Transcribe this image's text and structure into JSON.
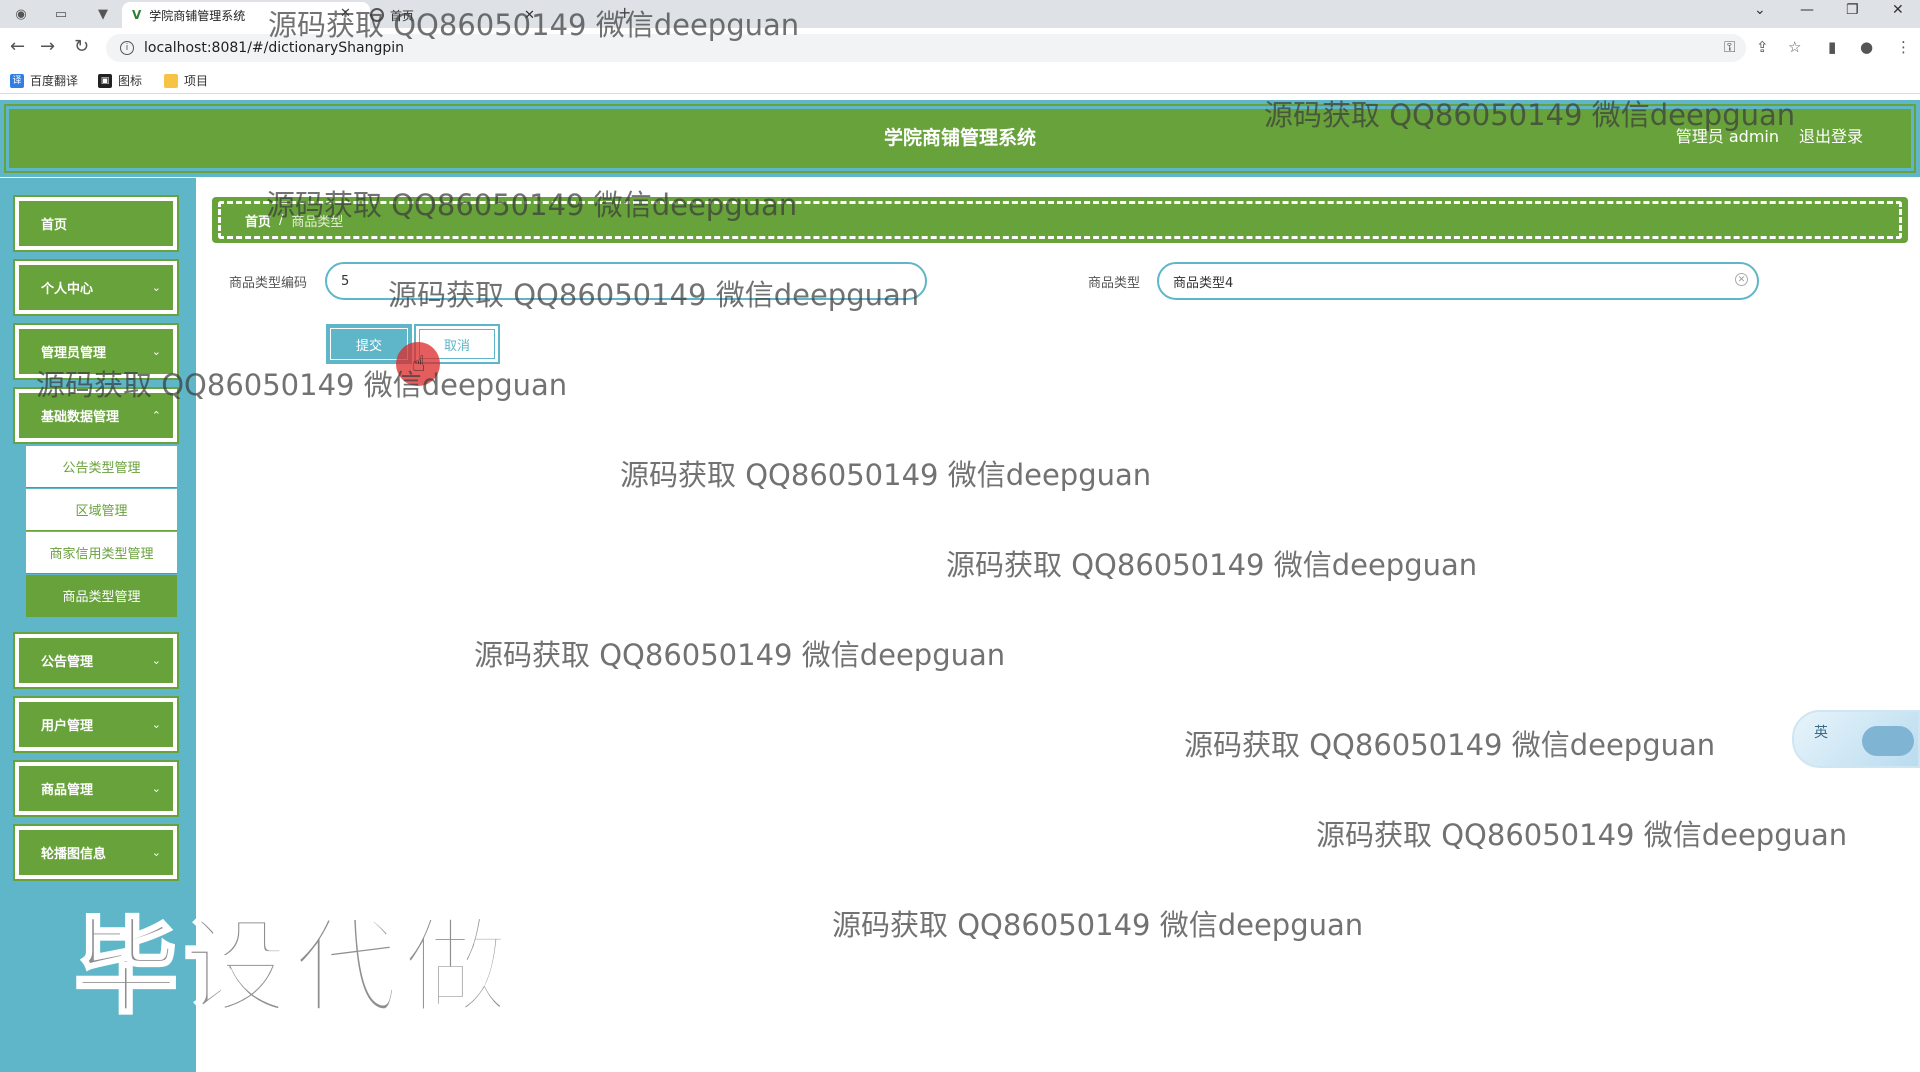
{
  "browser": {
    "tab_title": "学院商铺管理系统",
    "tab2_title": "首页",
    "url": "localhost:8081/#/dictionaryShangpin",
    "bookmarks": [
      "百度翻译",
      "图标",
      "项目"
    ]
  },
  "header": {
    "title": "学院商铺管理系统",
    "user": "管理员 admin",
    "logout": "退出登录"
  },
  "sidebar": {
    "items": [
      {
        "label": "首页"
      },
      {
        "label": "个人中心"
      },
      {
        "label": "管理员管理"
      },
      {
        "label": "基础数据管理"
      },
      {
        "label": "公告管理"
      },
      {
        "label": "用户管理"
      },
      {
        "label": "商品管理"
      },
      {
        "label": "轮播图信息"
      }
    ],
    "submenu": [
      {
        "label": "公告类型管理"
      },
      {
        "label": "区域管理"
      },
      {
        "label": "商家信用类型管理"
      },
      {
        "label": "商品类型管理"
      }
    ]
  },
  "breadcrumb": {
    "home": "首页",
    "separator": "/",
    "current": "商品类型"
  },
  "form": {
    "code_label": "商品类型编码",
    "code_value": "5",
    "type_label": "商品类型",
    "type_value": "商品类型4",
    "submit": "提交",
    "cancel": "取消"
  },
  "watermarks": {
    "text": "源码获取 QQ86050149 微信deepguan",
    "big": "毕设代做"
  },
  "ime": {
    "label": "英"
  },
  "colors": {
    "green": "#68a23b",
    "teal": "#5fb6c9"
  }
}
